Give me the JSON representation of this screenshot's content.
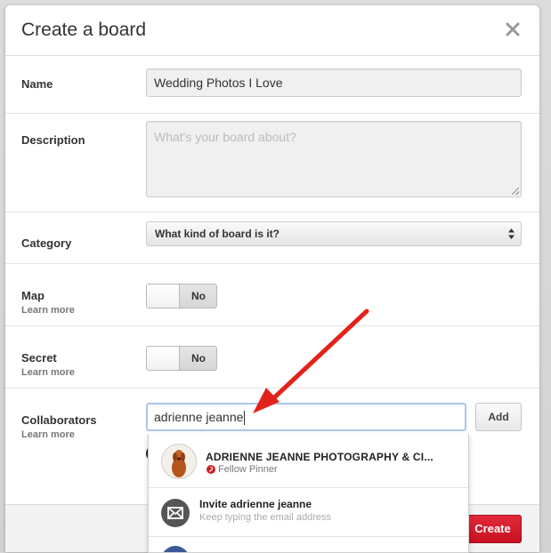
{
  "dialog": {
    "title": "Create a board",
    "close_glyph": "✕"
  },
  "form": {
    "name": {
      "label": "Name",
      "value": "Wedding Photos I Love"
    },
    "description": {
      "label": "Description",
      "placeholder": "What's your board about?"
    },
    "category": {
      "label": "Category",
      "selected": "What kind of board is it?"
    },
    "map": {
      "label": "Map",
      "link": "Learn more",
      "toggle_value": "No"
    },
    "secret": {
      "label": "Secret",
      "link": "Learn more",
      "toggle_value": "No"
    },
    "collaborators": {
      "label": "Collaborators",
      "link": "Learn more",
      "value": "adrienne jeanne",
      "add_label": "Add"
    }
  },
  "suggestions": [
    {
      "title": "ADRIENNE JEANNE PHOTOGRAPHY & CI...",
      "subtitle": "Fellow Pinner",
      "icon": "avatar-photo"
    },
    {
      "title": "Invite adrienne jeanne",
      "subtitle": "Keep typing the email address",
      "icon": "mail-icon"
    }
  ],
  "footer": {
    "create_label": "Create"
  },
  "colors": {
    "accent_red": "#cb2027",
    "annotation_arrow": "#e2231a",
    "focus_border": "#a9c6ea"
  }
}
